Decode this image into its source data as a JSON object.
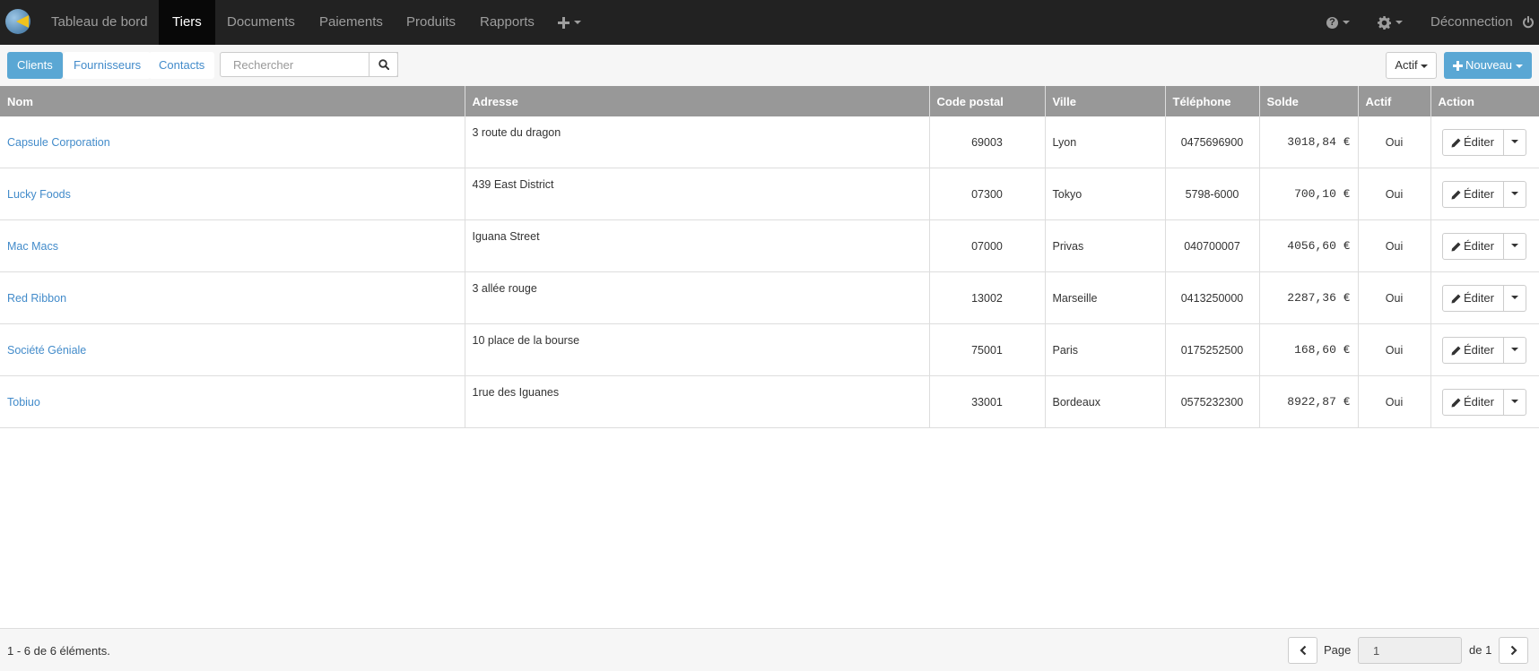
{
  "nav": {
    "items": [
      {
        "label": "Tableau de bord"
      },
      {
        "label": "Tiers"
      },
      {
        "label": "Documents"
      },
      {
        "label": "Paiements"
      },
      {
        "label": "Produits"
      },
      {
        "label": "Rapports"
      }
    ],
    "logout_label": "Déconnection"
  },
  "toolbar": {
    "tabs": [
      {
        "label": "Clients"
      },
      {
        "label": "Fournisseurs"
      },
      {
        "label": "Contacts"
      }
    ],
    "search_placeholder": "Rechercher",
    "filter_label": "Actif",
    "new_label": "Nouveau"
  },
  "table": {
    "columns": [
      "Nom",
      "Adresse",
      "Code postal",
      "Ville",
      "Téléphone",
      "Solde",
      "Actif",
      "Action"
    ],
    "rows": [
      {
        "name": "Capsule Corporation",
        "address": "3 route du dragon",
        "postal": "69003",
        "city": "Lyon",
        "phone": "0475696900",
        "balance": "3018,84 €",
        "active": "Oui"
      },
      {
        "name": "Lucky Foods",
        "address": "439 East District",
        "postal": "07300",
        "city": "Tokyo",
        "phone": "5798-6000",
        "balance": "700,10 €",
        "active": "Oui"
      },
      {
        "name": "Mac Macs",
        "address": "Iguana Street",
        "postal": "07000",
        "city": "Privas",
        "phone": "040700007",
        "balance": "4056,60 €",
        "active": "Oui"
      },
      {
        "name": "Red Ribbon",
        "address": "3 allée rouge",
        "postal": "13002",
        "city": "Marseille",
        "phone": "0413250000",
        "balance": "2287,36 €",
        "active": "Oui"
      },
      {
        "name": "Société Géniale",
        "address": "10 place de la bourse",
        "postal": "75001",
        "city": "Paris",
        "phone": "0175252500",
        "balance": "168,60 €",
        "active": "Oui"
      },
      {
        "name": "Tobiuo",
        "address": "1rue des Iguanes",
        "postal": "33001",
        "city": "Bordeaux",
        "phone": "0575232300",
        "balance": "8922,87 €",
        "active": "Oui"
      }
    ],
    "edit_label": "Éditer"
  },
  "footer": {
    "info": "1 - 6 de 6 éléments.",
    "page_label": "Page",
    "page_value": "1",
    "page_total": "de 1"
  },
  "colors": {
    "navbar": "#222222",
    "nav_active": "#080808",
    "accent": "#5aa7d4",
    "link": "#428bca",
    "table_header": "#989898"
  }
}
